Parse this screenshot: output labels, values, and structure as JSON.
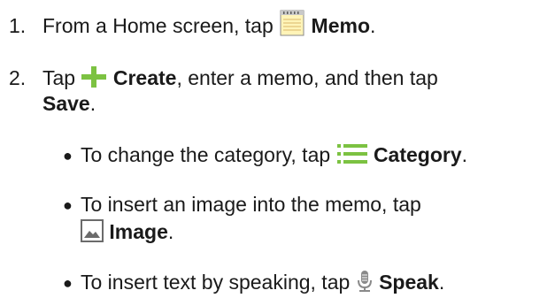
{
  "steps": [
    {
      "number": "1.",
      "text_before": "From a Home screen, tap",
      "icon": "memo-icon",
      "bold": "Memo",
      "text_after": "."
    },
    {
      "number": "2.",
      "text_before": "Tap",
      "icon": "plus-icon",
      "bold": "Create",
      "text_after": ", enter a memo, and then tap",
      "bold2": "Save",
      "text_after2": "."
    }
  ],
  "bullets": [
    {
      "text_before": "To change the category, tap",
      "icon": "category-list-icon",
      "bold": "Category",
      "text_after": "."
    },
    {
      "text_before": "To insert an image into the memo, tap",
      "icon": "image-icon",
      "bold": "Image",
      "text_after": "."
    },
    {
      "text_before": "To insert text by speaking, tap",
      "icon": "microphone-icon",
      "bold": "Speak",
      "text_after": "."
    }
  ],
  "colors": {
    "accent_green": "#7cc242",
    "memo_icon_yellow": "#fff4b8",
    "image_icon_gray": "#6b6b6b"
  }
}
